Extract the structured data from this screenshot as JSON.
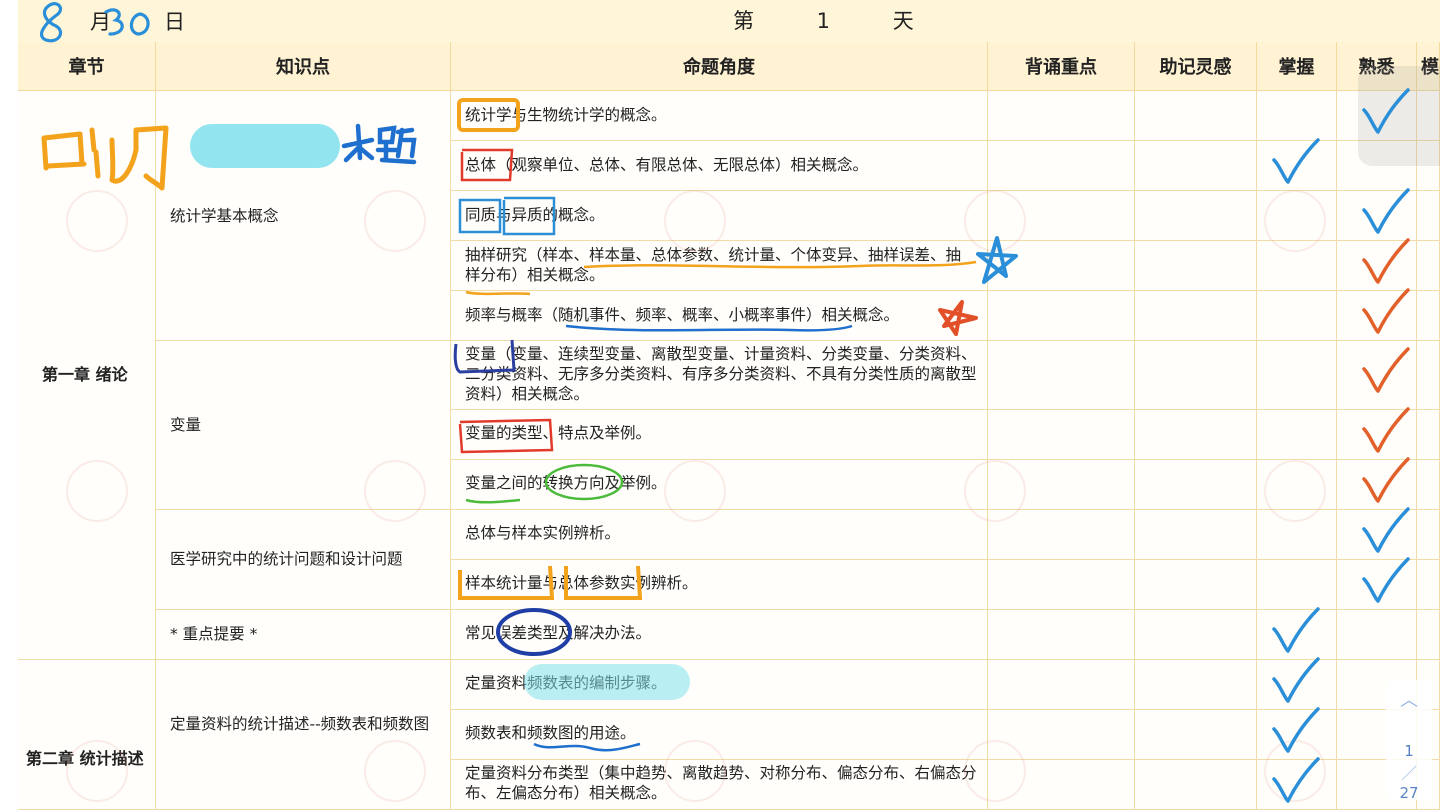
{
  "header": {
    "month_handwritten": "8",
    "month_label": "月",
    "day_handwritten": "30",
    "day_label": "日",
    "day_title": "第 1 天"
  },
  "columns": [
    "章节",
    "知识点",
    "命题角度",
    "背诵重点",
    "助记灵感",
    "掌握",
    "熟悉",
    "模"
  ],
  "chapters": [
    {
      "label": "第一章 绪论"
    },
    {
      "label": "第二章 统计描述"
    }
  ],
  "knowledge_points": [
    {
      "label": "统计学基本概念"
    },
    {
      "label": "变量"
    },
    {
      "label": "医学研究中的统计问题和设计问题"
    },
    {
      "label": "* 重点提要 *"
    },
    {
      "label": "定量资料的统计描述--频数表和频数图"
    }
  ],
  "topics": [
    {
      "label": "统计学与生物统计学的概念。",
      "check": "熟悉"
    },
    {
      "label": "总体（观察单位、总体、有限总体、无限总体）相关概念。",
      "check": "掌握"
    },
    {
      "label": "同质与异质的概念。",
      "check": "熟悉"
    },
    {
      "label": "抽样研究（样本、样本量、总体参数、统计量、个体变异、抽样误差、抽样分布）相关概念。",
      "check": "熟悉"
    },
    {
      "label": "频率与概率（随机事件、频率、概率、小概率事件）相关概念。",
      "check": "熟悉"
    },
    {
      "label": "变量（变量、连续型变量、离散型变量、计量资料、分类变量、分类资料、二分类资料、无序多分类资料、有序多分类资料、不具有分类性质的离散型资料）相关概念。",
      "check": "熟悉"
    },
    {
      "label": "变量的类型、特点及举例。",
      "check": "熟悉"
    },
    {
      "label": "变量之间的转换方向及举例。",
      "check": "熟悉"
    },
    {
      "label": "总体与样本实例辨析。",
      "check": "熟悉"
    },
    {
      "label": "样本统计量与总体参数实例辨析。",
      "check": "熟悉"
    },
    {
      "label": "常见误差类型及解决办法。",
      "check": "掌握"
    },
    {
      "label": "定量资料频数表的编制步骤。",
      "check": "掌握"
    },
    {
      "label": "频数表和频数图的用途。",
      "check": "掌握"
    },
    {
      "label": "定量资料分布类型（集中趋势、离散趋势、对称分布、偏态分布、右偏态分布、左偏态分布）相关概念。",
      "check": "掌握"
    }
  ],
  "handwriting": {
    "left_note": "口诀",
    "big_question": "大题"
  },
  "pager": {
    "current": "1",
    "total": "27"
  },
  "colors": {
    "header_bg": "#fff6d9",
    "column_header_bg": "#fff3d3",
    "grid": "#f1dba6",
    "ink_orange": "#f3a21c",
    "ink_blue": "#2a8fd8",
    "ink_red": "#e23a2a",
    "ink_navy": "#2b3fa0",
    "ink_green": "#4cbb3b",
    "highlight_cyan": "#7fe0ec"
  }
}
